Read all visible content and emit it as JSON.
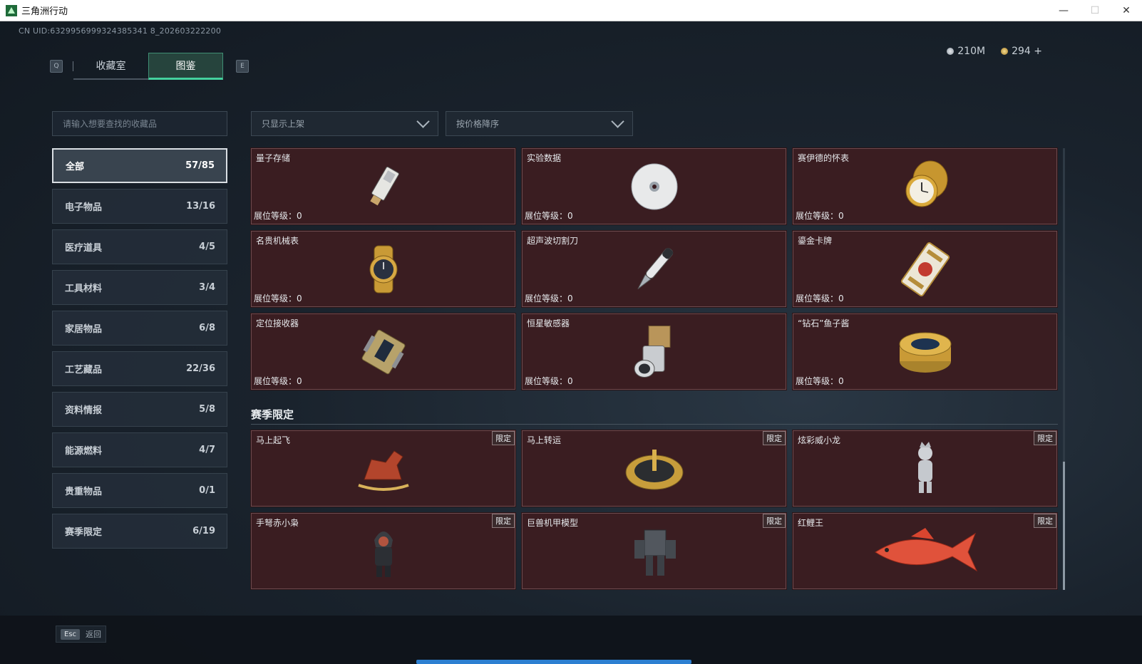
{
  "window": {
    "title": "三角洲行动",
    "controls": [
      "—",
      "☐",
      "✕"
    ]
  },
  "uid": "CN UID:6329956999324385341 8_202603222200",
  "tabs": {
    "q_key": "Q",
    "e_key": "E",
    "items": [
      {
        "label": "收藏室"
      },
      {
        "label": "图鉴"
      }
    ],
    "active": 1
  },
  "currency": {
    "silver": "210M",
    "gold": "294",
    "gold_plus": "+"
  },
  "search": {
    "placeholder": "请输入想要查找的收藏品"
  },
  "filters": {
    "listing": "只显示上架",
    "sort": "按价格降序"
  },
  "categories": [
    {
      "label": "全部",
      "count": "57/85",
      "active": true
    },
    {
      "label": "电子物品",
      "count": "13/16"
    },
    {
      "label": "医疗道具",
      "count": "4/5"
    },
    {
      "label": "工具材料",
      "count": "3/4"
    },
    {
      "label": "家居物品",
      "count": "6/8"
    },
    {
      "label": "工艺藏品",
      "count": "22/36"
    },
    {
      "label": "资料情报",
      "count": "5/8"
    },
    {
      "label": "能源燃料",
      "count": "4/7"
    },
    {
      "label": "贵重物品",
      "count": "0/1"
    },
    {
      "label": "赛季限定",
      "count": "6/19"
    }
  ],
  "items": [
    {
      "name": "量子存储",
      "level": "展位等级：0",
      "icon": "usb-drive-icon"
    },
    {
      "name": "实验数据",
      "level": "展位等级：0",
      "icon": "disc-icon"
    },
    {
      "name": "赛伊德的怀表",
      "level": "展位等级：0",
      "icon": "pocket-watch-icon"
    },
    {
      "name": "名贵机械表",
      "level": "展位等级：0",
      "icon": "wristwatch-icon"
    },
    {
      "name": "超声波切割刀",
      "level": "展位等级：0",
      "icon": "cutter-icon"
    },
    {
      "name": "鎏金卡牌",
      "level": "展位等级：0",
      "icon": "card-icon"
    },
    {
      "name": "定位接收器",
      "level": "展位等级：0",
      "icon": "receiver-icon"
    },
    {
      "name": "恒星敏感器",
      "level": "展位等级：0",
      "icon": "sensor-icon"
    },
    {
      "name": "“钻石”鱼子酱",
      "level": "展位等级：0",
      "icon": "caviar-tin-icon"
    }
  ],
  "season": {
    "title": "赛季限定",
    "badge": "限定",
    "items": [
      {
        "name": "马上起飞",
        "icon": "rocking-horse-icon"
      },
      {
        "name": "马上转运",
        "icon": "roulette-icon"
      },
      {
        "name": "炫彩威小龙",
        "icon": "figurine-icon"
      },
      {
        "name": "手弩赤小枭",
        "icon": "hooded-figure-icon"
      },
      {
        "name": "巨兽机甲模型",
        "icon": "mech-model-icon"
      },
      {
        "name": "红鲤王",
        "icon": "red-carp-icon"
      }
    ]
  },
  "footer": {
    "esc_key": "Esc",
    "back_label": "返回"
  }
}
